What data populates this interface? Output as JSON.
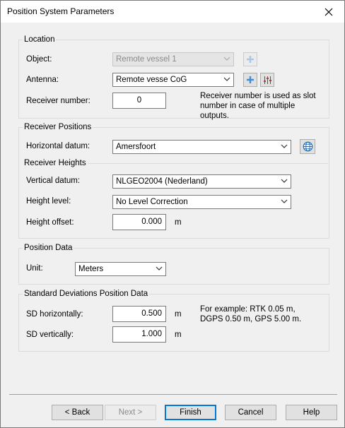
{
  "window": {
    "title": "Position System Parameters"
  },
  "location": {
    "group_label": "Location",
    "object_label": "Object:",
    "object_value": "Remote vessel 1",
    "antenna_label": "Antenna:",
    "antenna_value": "Remote vesse CoG",
    "receiver_label": "Receiver number:",
    "receiver_value": "0",
    "receiver_note": "Receiver number is used as slot number in case of multiple outputs."
  },
  "receiver_positions": {
    "group_label": "Receiver Positions",
    "hdatum_label": "Horizontal datum:",
    "hdatum_value": "Amersfoort"
  },
  "receiver_heights": {
    "group_label": "Receiver Heights",
    "vdatum_label": "Vertical datum:",
    "vdatum_value": "NLGEO2004 (Nederland)",
    "level_label": "Height level:",
    "level_value": "No Level Correction",
    "offset_label": "Height offset:",
    "offset_value": "0.000",
    "offset_unit": "m"
  },
  "position_data": {
    "group_label": "Position Data",
    "unit_label": "Unit:",
    "unit_value": "Meters"
  },
  "sd": {
    "group_label": "Standard Deviations Position Data",
    "h_label": "SD horizontally:",
    "h_value": "0.500",
    "h_unit": "m",
    "v_label": "SD vertically:",
    "v_value": "1.000",
    "v_unit": "m",
    "note": "For example: RTK 0.05 m, DGPS 0.50 m, GPS 5.00 m."
  },
  "buttons": {
    "back": "< Back",
    "next": "Next >",
    "finish": "Finish",
    "cancel": "Cancel",
    "help": "Help"
  },
  "colors": {
    "accent": "#0078d7",
    "plus_icon": "#3c8fd8",
    "globe_icon": "#1a6fc4"
  }
}
